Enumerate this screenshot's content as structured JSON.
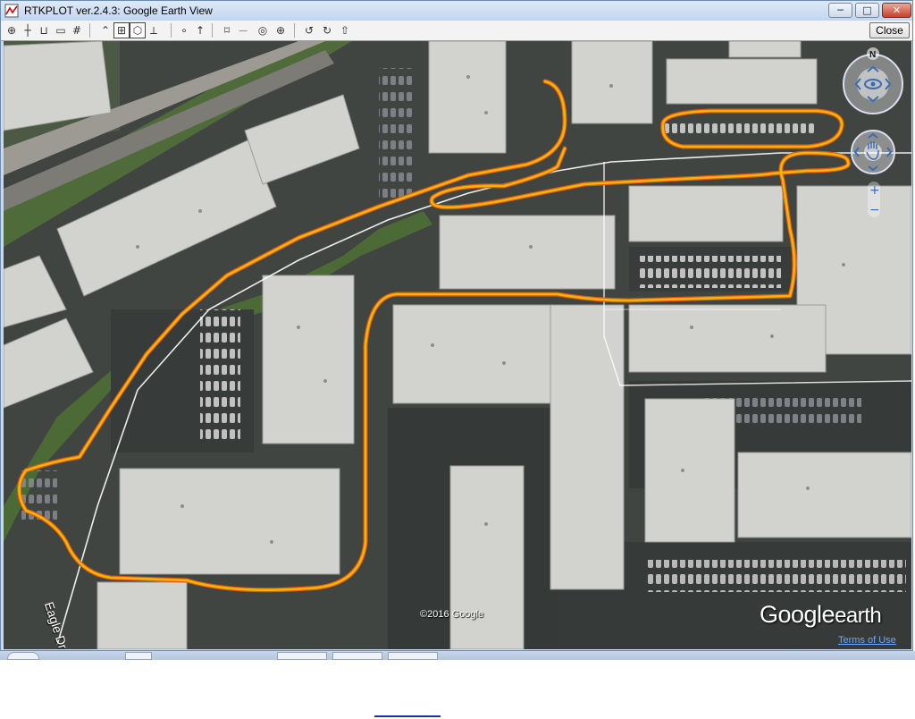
{
  "window": {
    "title": "RTKPLOT ver.2.4.3: Google Earth View",
    "controls": {
      "minimize": "─",
      "maximize": "□",
      "close": "✕"
    }
  },
  "toolbar": {
    "tools": [
      {
        "name": "target-icon",
        "glyph": "⊕"
      },
      {
        "name": "crosshair-icon",
        "glyph": "┼"
      },
      {
        "name": "scale-icon",
        "glyph": "⊔"
      },
      {
        "name": "grid-box-icon",
        "glyph": "▭"
      },
      {
        "name": "number-icon",
        "glyph": "#"
      },
      {
        "name": "polyline-icon",
        "glyph": "⌃"
      },
      {
        "name": "show-grid-icon",
        "glyph": "⊞",
        "active": true
      },
      {
        "name": "box-3d-icon",
        "glyph": "⬡",
        "active": true
      },
      {
        "name": "axis-icon",
        "glyph": "⟂"
      },
      {
        "name": "dot-icon",
        "glyph": "∘"
      },
      {
        "name": "arrow-up-icon",
        "glyph": "↑"
      },
      {
        "name": "frame-icon",
        "glyph": "⌑"
      },
      {
        "name": "measure-icon",
        "glyph": "⏤"
      },
      {
        "name": "comment-icon",
        "glyph": "◎"
      },
      {
        "name": "zoom-plus-icon",
        "glyph": "⊕"
      },
      {
        "name": "rotate-left-icon",
        "glyph": "↺"
      },
      {
        "name": "rotate-right-icon",
        "glyph": "↻"
      },
      {
        "name": "up-circle-icon",
        "glyph": "⇧"
      }
    ],
    "close_label": "Close"
  },
  "map": {
    "road_label": "Eagle Dr",
    "copyright": "©2016 Google",
    "logo_word1": "Google",
    "logo_word2": "earth",
    "terms": "Terms of Use",
    "north_label": "N",
    "zoom_plus": "+",
    "zoom_minus": "−",
    "track_color": "#f5b40a",
    "track_edge_color": "#e05a10",
    "boundary_color": "#ffffff"
  }
}
